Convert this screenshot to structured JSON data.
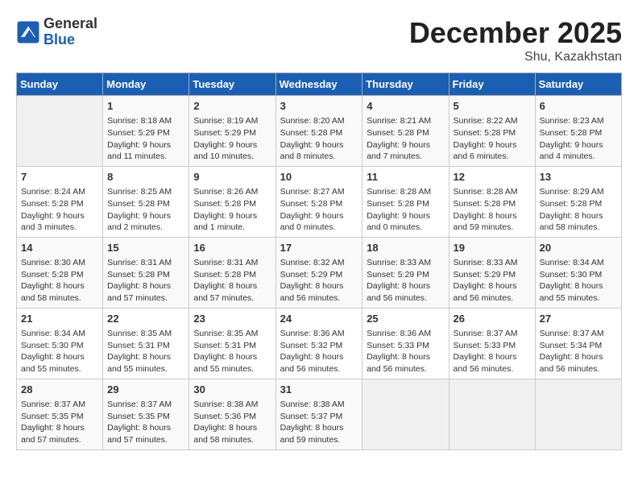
{
  "header": {
    "logo": {
      "general": "General",
      "blue": "Blue"
    },
    "title": "December 2025",
    "location": "Shu, Kazakhstan"
  },
  "calendar": {
    "weekdays": [
      "Sunday",
      "Monday",
      "Tuesday",
      "Wednesday",
      "Thursday",
      "Friday",
      "Saturday"
    ],
    "weeks": [
      [
        {
          "day": "",
          "info": ""
        },
        {
          "day": "1",
          "info": "Sunrise: 8:18 AM\nSunset: 5:29 PM\nDaylight: 9 hours\nand 11 minutes."
        },
        {
          "day": "2",
          "info": "Sunrise: 8:19 AM\nSunset: 5:29 PM\nDaylight: 9 hours\nand 10 minutes."
        },
        {
          "day": "3",
          "info": "Sunrise: 8:20 AM\nSunset: 5:28 PM\nDaylight: 9 hours\nand 8 minutes."
        },
        {
          "day": "4",
          "info": "Sunrise: 8:21 AM\nSunset: 5:28 PM\nDaylight: 9 hours\nand 7 minutes."
        },
        {
          "day": "5",
          "info": "Sunrise: 8:22 AM\nSunset: 5:28 PM\nDaylight: 9 hours\nand 6 minutes."
        },
        {
          "day": "6",
          "info": "Sunrise: 8:23 AM\nSunset: 5:28 PM\nDaylight: 9 hours\nand 4 minutes."
        }
      ],
      [
        {
          "day": "7",
          "info": "Sunrise: 8:24 AM\nSunset: 5:28 PM\nDaylight: 9 hours\nand 3 minutes."
        },
        {
          "day": "8",
          "info": "Sunrise: 8:25 AM\nSunset: 5:28 PM\nDaylight: 9 hours\nand 2 minutes."
        },
        {
          "day": "9",
          "info": "Sunrise: 8:26 AM\nSunset: 5:28 PM\nDaylight: 9 hours\nand 1 minute."
        },
        {
          "day": "10",
          "info": "Sunrise: 8:27 AM\nSunset: 5:28 PM\nDaylight: 9 hours\nand 0 minutes."
        },
        {
          "day": "11",
          "info": "Sunrise: 8:28 AM\nSunset: 5:28 PM\nDaylight: 9 hours\nand 0 minutes."
        },
        {
          "day": "12",
          "info": "Sunrise: 8:28 AM\nSunset: 5:28 PM\nDaylight: 8 hours\nand 59 minutes."
        },
        {
          "day": "13",
          "info": "Sunrise: 8:29 AM\nSunset: 5:28 PM\nDaylight: 8 hours\nand 58 minutes."
        }
      ],
      [
        {
          "day": "14",
          "info": "Sunrise: 8:30 AM\nSunset: 5:28 PM\nDaylight: 8 hours\nand 58 minutes."
        },
        {
          "day": "15",
          "info": "Sunrise: 8:31 AM\nSunset: 5:28 PM\nDaylight: 8 hours\nand 57 minutes."
        },
        {
          "day": "16",
          "info": "Sunrise: 8:31 AM\nSunset: 5:28 PM\nDaylight: 8 hours\nand 57 minutes."
        },
        {
          "day": "17",
          "info": "Sunrise: 8:32 AM\nSunset: 5:29 PM\nDaylight: 8 hours\nand 56 minutes."
        },
        {
          "day": "18",
          "info": "Sunrise: 8:33 AM\nSunset: 5:29 PM\nDaylight: 8 hours\nand 56 minutes."
        },
        {
          "day": "19",
          "info": "Sunrise: 8:33 AM\nSunset: 5:29 PM\nDaylight: 8 hours\nand 56 minutes."
        },
        {
          "day": "20",
          "info": "Sunrise: 8:34 AM\nSunset: 5:30 PM\nDaylight: 8 hours\nand 55 minutes."
        }
      ],
      [
        {
          "day": "21",
          "info": "Sunrise: 8:34 AM\nSunset: 5:30 PM\nDaylight: 8 hours\nand 55 minutes."
        },
        {
          "day": "22",
          "info": "Sunrise: 8:35 AM\nSunset: 5:31 PM\nDaylight: 8 hours\nand 55 minutes."
        },
        {
          "day": "23",
          "info": "Sunrise: 8:35 AM\nSunset: 5:31 PM\nDaylight: 8 hours\nand 55 minutes."
        },
        {
          "day": "24",
          "info": "Sunrise: 8:36 AM\nSunset: 5:32 PM\nDaylight: 8 hours\nand 56 minutes."
        },
        {
          "day": "25",
          "info": "Sunrise: 8:36 AM\nSunset: 5:33 PM\nDaylight: 8 hours\nand 56 minutes."
        },
        {
          "day": "26",
          "info": "Sunrise: 8:37 AM\nSunset: 5:33 PM\nDaylight: 8 hours\nand 56 minutes."
        },
        {
          "day": "27",
          "info": "Sunrise: 8:37 AM\nSunset: 5:34 PM\nDaylight: 8 hours\nand 56 minutes."
        }
      ],
      [
        {
          "day": "28",
          "info": "Sunrise: 8:37 AM\nSunset: 5:35 PM\nDaylight: 8 hours\nand 57 minutes."
        },
        {
          "day": "29",
          "info": "Sunrise: 8:37 AM\nSunset: 5:35 PM\nDaylight: 8 hours\nand 57 minutes."
        },
        {
          "day": "30",
          "info": "Sunrise: 8:38 AM\nSunset: 5:36 PM\nDaylight: 8 hours\nand 58 minutes."
        },
        {
          "day": "31",
          "info": "Sunrise: 8:38 AM\nSunset: 5:37 PM\nDaylight: 8 hours\nand 59 minutes."
        },
        {
          "day": "",
          "info": ""
        },
        {
          "day": "",
          "info": ""
        },
        {
          "day": "",
          "info": ""
        }
      ]
    ]
  }
}
